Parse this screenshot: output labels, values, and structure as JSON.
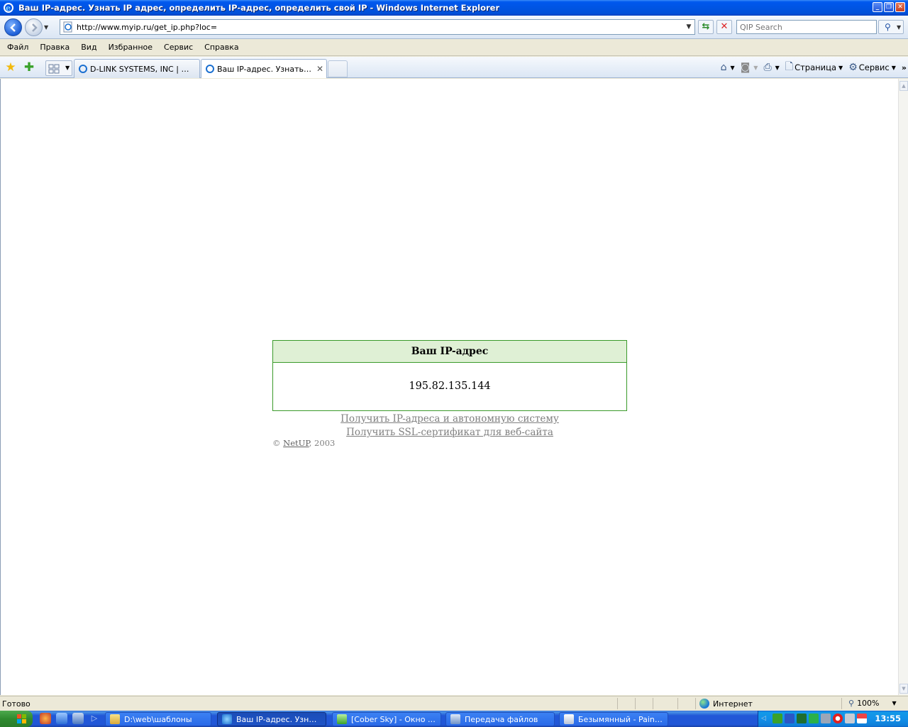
{
  "window": {
    "title": "Ваш IP-адрес. Узнать IP адрес, определить IP-адрес, определить свой IP - Windows Internet Explorer"
  },
  "addressbar": {
    "url": "http://www.myip.ru/get_ip.php?loc=",
    "search_placeholder": "QIP Search"
  },
  "menu": {
    "items": [
      "Файл",
      "Правка",
      "Вид",
      "Избранное",
      "Сервис",
      "Справка"
    ]
  },
  "tabs": [
    {
      "label": "D-LINK SYSTEMS, INC | WIR..."
    },
    {
      "label": "Ваш IP-адрес. Узнать IP..."
    }
  ],
  "commandbar": {
    "page_label": "Страница",
    "tools_label": "Сервис"
  },
  "page": {
    "box_title": "Ваш IP-адрес",
    "ip_address": "195.82.135.144",
    "link1": "Получить IP-адреса и автономную систему",
    "link2": "Получить SSL-сертификат для веб-сайта",
    "copyright_prefix": "© ",
    "copyright_link": "NetUP",
    "copyright_suffix": ", 2003"
  },
  "statusbar": {
    "status": "Готово",
    "zone": "Интернет",
    "zoom": "100%"
  },
  "taskbar": {
    "items": [
      {
        "label": "D:\\web\\шаблоны"
      },
      {
        "label": "Ваш IP-адрес. Узнат..."
      },
      {
        "label": "[Cober Sky] - Окно со..."
      },
      {
        "label": "Передача файлов"
      },
      {
        "label": "Безымянный - Paint.N..."
      }
    ],
    "clock": "13:55"
  },
  "colors": {
    "box_border": "#3a9a2a",
    "box_header_bg": "#dff0d5",
    "link_color": "#808080"
  }
}
